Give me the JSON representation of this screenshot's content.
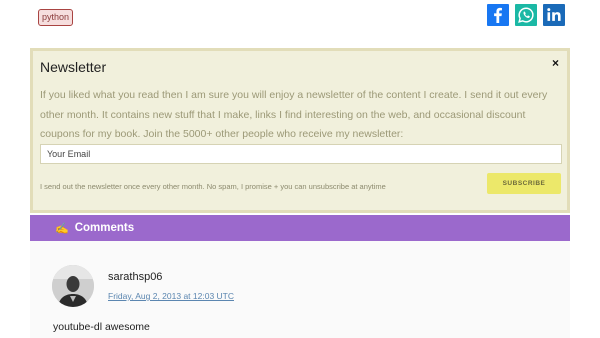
{
  "tag": {
    "label": "python"
  },
  "share": [
    {
      "name": "facebook",
      "icon": "facebook-icon",
      "color": "#1877f2"
    },
    {
      "name": "whatsapp",
      "icon": "whatsapp-icon",
      "color": "#1bb8a5"
    },
    {
      "name": "linkedin",
      "icon": "linkedin-icon",
      "color": "#1a6ab8"
    }
  ],
  "newsletter": {
    "title": "Newsletter",
    "close": "×",
    "body": "If you liked what you read then I am sure you will enjoy a newsletter of the content I create. I send it out every other month. It contains new stuff that I make, links I find interesting on the web, and occasional discount coupons for my book. Join the 5000+ other people who receive my newsletter:",
    "email_placeholder": "Your Email",
    "email_value": "",
    "note": "I send out the newsletter once every other month. No spam, I promise + you can unsubscribe at anytime",
    "subscribe_label": "SUBSCRIBE",
    "background_color": "#f1f0dc",
    "button_color": "#ece86a"
  },
  "comments": {
    "icon": "✍",
    "title": "Comments",
    "bar_color": "#9b69cc",
    "items": [
      {
        "author": "sarathsp06",
        "date": "Friday, Aug 2, 2013 at 12:03 UTC",
        "text": "youtube-dl awesome"
      }
    ]
  }
}
